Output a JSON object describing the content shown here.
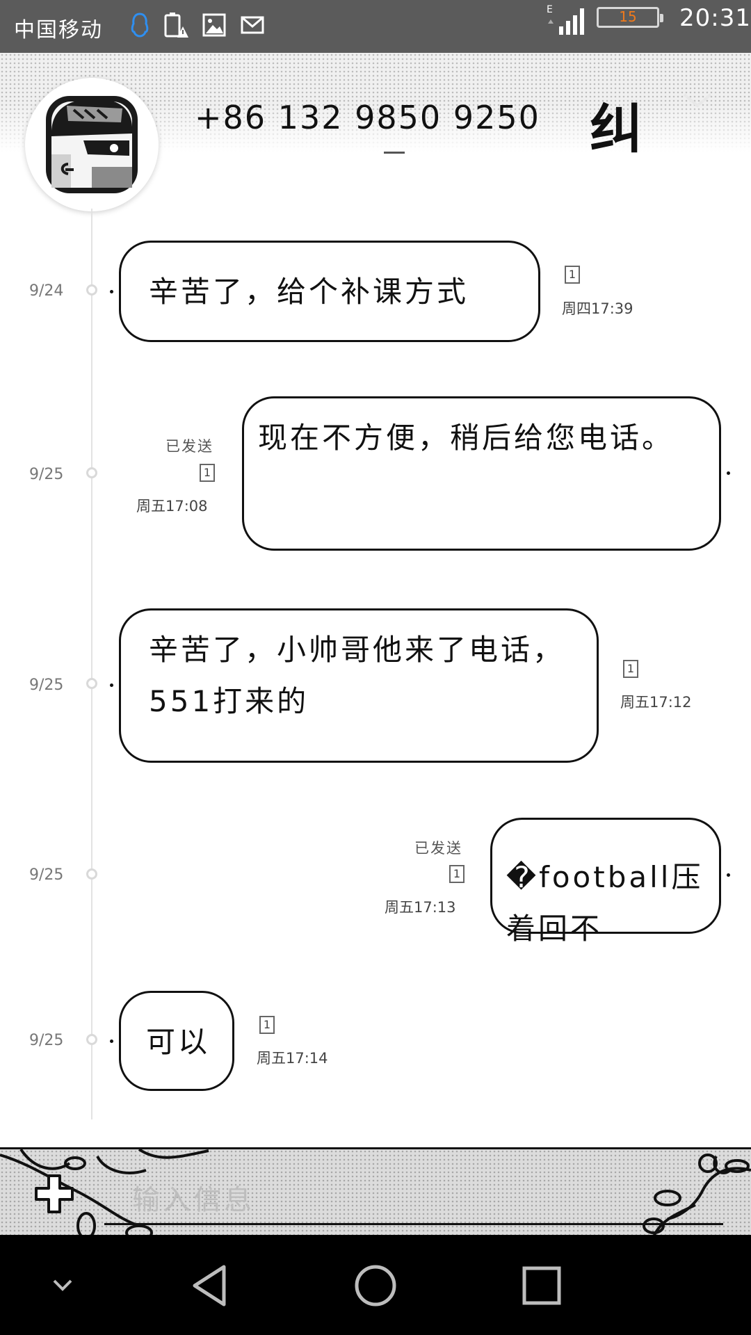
{
  "status_bar": {
    "carrier": "中国移动",
    "network_type": "E",
    "battery_level": "15",
    "time": "20:31",
    "battery_color": "#f07a1c"
  },
  "header": {
    "phone_number": "+86 132 9850 9250",
    "contact_mark": "纠"
  },
  "messages": [
    {
      "date": "9/24",
      "direction": "received",
      "text": "辛苦了，给个补课方式",
      "sim": "1",
      "time": "周四17:39"
    },
    {
      "date": "9/25",
      "direction": "sent",
      "status": "已发送",
      "text": "现在不方便，稍后给您电话。",
      "sim": "1",
      "time": "周五17:08"
    },
    {
      "date": "9/25",
      "direction": "received",
      "text": "辛苦了，小帅哥他来了电话，551打来的",
      "sim": "1",
      "time": "周五17:12"
    },
    {
      "date": "9/25",
      "direction": "sent",
      "status": "已发送",
      "text": "�football压着回不",
      "sim": "1",
      "time": "周五17:13"
    },
    {
      "date": "9/25",
      "direction": "received",
      "text": "可以",
      "sim": "1",
      "time": "周五17:14"
    }
  ],
  "composer": {
    "placeholder": "输入信息"
  }
}
